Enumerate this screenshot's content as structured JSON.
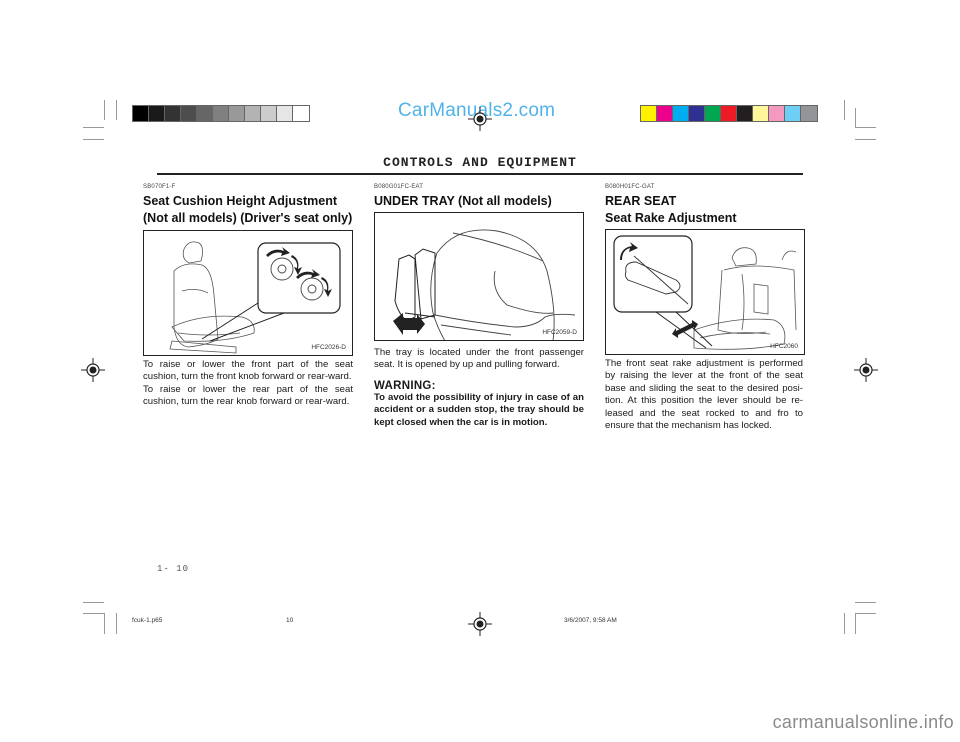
{
  "watermark_top": "CarManuals2.com",
  "watermark_bottom": "carmanualsonline.info",
  "grayscale_swatches": [
    "#000000",
    "#1a1a1a",
    "#333333",
    "#4d4d4d",
    "#666666",
    "#808080",
    "#999999",
    "#b3b3b3",
    "#cccccc",
    "#e6e6e6",
    "#ffffff"
  ],
  "color_swatches": [
    "#fff200",
    "#ec008c",
    "#00aeef",
    "#2e3192",
    "#00a651",
    "#ed1c24",
    "#231f20",
    "#fff799",
    "#f49ac1",
    "#6dcff6",
    "#939598"
  ],
  "header": {
    "title": "CONTROLS AND EQUIPMENT"
  },
  "sections": [
    {
      "code": "SB070F1-F",
      "title_lines": [
        "Seat Cushion Height Adjustment",
        "(Not all models) (Driver's seat only)"
      ],
      "figure_label": "HFC2026-D",
      "paragraphs": [
        "To raise or lower the front part of the seat cushion, turn the front knob forward or rear-ward.",
        "To raise or lower the rear part of the seat cushion, turn the rear knob forward or rear-ward."
      ]
    },
    {
      "code": "B080G01FC-EAT",
      "title_lines": [
        "UNDER TRAY (Not all models)"
      ],
      "figure_label": "HFC2059-D",
      "paragraphs": [
        "The tray is located under the front passenger seat. It is opened by up and pulling forward."
      ],
      "warning_title": "WARNING:",
      "warning_text": "To avoid the possibility of injury in case of an accident or a sudden stop, the tray should be kept closed when the car is in motion."
    },
    {
      "code": "B080H01FC-GAT",
      "title_lines": [
        "REAR SEAT",
        "Seat Rake Adjustment"
      ],
      "figure_label": "HFC2060",
      "paragraphs": [
        "The front seat rake adjustment is performed by raising the lever at the front of the seat base and sliding the seat to the desired posi-tion. At this position the lever should be re-leased and the seat rocked to and fro to ensure that the mechanism has locked."
      ]
    }
  ],
  "page_number": "1- 10",
  "footer": {
    "filename": "fcuk-1.p65",
    "page": "10",
    "timestamp": "3/6/2007, 9:58 AM"
  }
}
